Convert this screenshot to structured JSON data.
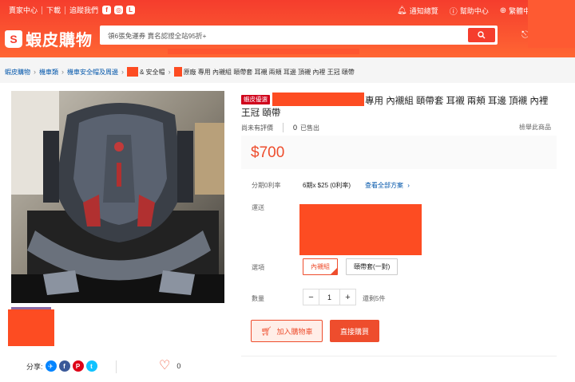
{
  "topbar": {
    "seller_center": "賣家中心",
    "download": "下載",
    "follow_us": "追蹤我們",
    "notifications": "通知總覽",
    "help": "幫助中心",
    "language": "繁體中文"
  },
  "brand": {
    "logo_letter": "S",
    "name": "蝦皮購物"
  },
  "search": {
    "placeholder": "領6張免運券 賣名認證全站95折+"
  },
  "breadcrumb": {
    "items": [
      "蝦皮購物",
      "機車類",
      "機車安全帽及周邊"
    ],
    "partial_1": "& 安全帽",
    "partial_2": "原廠 專用 內襯組 頤帶套 耳襯 兩頰 耳邊 頂襯 內裡 王冠 頤帶"
  },
  "product": {
    "badge": "蝦皮優選",
    "title_line1": "專用 內襯組 頤帶套 耳襯 兩頰 耳邊 頂襯 內裡",
    "title_line2": "王冠 頤帶",
    "no_rating": "尚未有評價",
    "sold_count": "0",
    "sold_label": "已售出",
    "report": "檢舉此商品",
    "price": "$700",
    "installment_label": "分期0利率",
    "installment_value": "6期x $25 (0利率)",
    "installment_link": "查看全部方案",
    "shipping_label": "運送",
    "option_label": "選項",
    "options": [
      "內襯組",
      "頤帶套(一對)"
    ],
    "quantity_label": "數量",
    "quantity": "1",
    "stock": "還剩5件",
    "add_to_cart": "加入購物車",
    "buy_now": "直接購買"
  },
  "social": {
    "share_label": "分享:",
    "like_count": "0"
  },
  "colors": {
    "brand": "#ee4d2d",
    "header": "#f53d2d"
  }
}
